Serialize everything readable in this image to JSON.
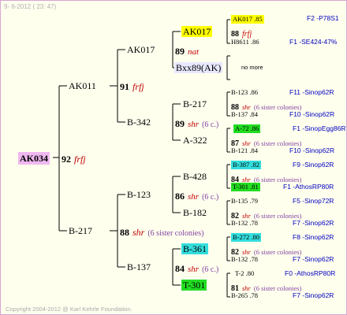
{
  "header": "9- 6-2012 ( 23: 47)",
  "footer": "Copyright 2004-2012 @ Karl Kehrle Foundation.",
  "colors": {
    "root_bg": "#f0b8f0",
    "yellow": "#ffff00",
    "green": "#22dd22",
    "cyan": "#33dddd",
    "blue_text": "#0000c0"
  },
  "root": {
    "name": "AK034",
    "num": "92",
    "type": "frfj"
  },
  "g1": [
    {
      "name": "AK011",
      "num": "91",
      "type": "frfj"
    },
    {
      "name": "B-217",
      "num": "88",
      "type": "shr",
      "sis": "(6 sister colonies)"
    }
  ],
  "g2": [
    {
      "name": "AK017",
      "num": "89",
      "type": "nat"
    },
    {
      "name": "B-342",
      "num": "89",
      "type": "shr",
      "sis": "(6 c.)"
    },
    {
      "name": "B-123",
      "num": "86",
      "type": "shr",
      "sis": "(6 c.)"
    },
    {
      "name": "B-137",
      "num": "84",
      "type": "shr",
      "sis": "(6 c.)"
    }
  ],
  "g3": [
    {
      "name": "AK017"
    },
    {
      "name": "Bxx89(AK)"
    },
    {
      "name": "B-217"
    },
    {
      "name": "A-322"
    },
    {
      "name": "B-428"
    },
    {
      "name": "B-182"
    },
    {
      "name": "B-361"
    },
    {
      "name": "T-301"
    }
  ],
  "g4": [
    {
      "top": "AK017 .85",
      "num": "88",
      "type": "frfj",
      "sis": "",
      "bot": "H8611 .86",
      "rtop": "F2 -P78S1",
      "rbot": "F1 -SE424-47%"
    },
    {
      "top": "",
      "num": "",
      "type": "",
      "sis": "no more",
      "bot": "",
      "rtop": "",
      "rbot": ""
    },
    {
      "top": "B-123 .86",
      "num": "88",
      "type": "shr",
      "sis": "(6 sister colonies)",
      "bot": "B-137 .84",
      "rtop": "F11 -Sinop62R",
      "rbot": "F10 -Sinop62R"
    },
    {
      "top": "A-72 .86",
      "num": "87",
      "type": "shr",
      "sis": "(6 sister colonies)",
      "bot": "B-121 .84",
      "rtop": "F1 -SinopEgg86R",
      "rbot": "F10 -Sinop62R"
    },
    {
      "top": "B-387 .82",
      "num": "84",
      "type": "shr",
      "sis": "(6 sister colonies)",
      "bot": "T-301 .81",
      "rtop": "F9 -Sinop62R",
      "rbot": "F1 -AthosRP80R"
    },
    {
      "top": "B-135 .79",
      "num": "82",
      "type": "shr",
      "sis": "(6 sister colonies)",
      "bot": "B-132 .78",
      "rtop": "F5 -Sinop72R",
      "rbot": "F7 -Sinop62R"
    },
    {
      "top": "B-272 .80",
      "num": "82",
      "type": "shr",
      "sis": "(6 sister colonies)",
      "bot": "B-132 .78",
      "rtop": "F8 -Sinop62R",
      "rbot": "F7 -Sinop62R"
    },
    {
      "top": "T-2 .80",
      "num": "81",
      "type": "shr",
      "sis": "(6 sister colonies)",
      "bot": "B-265 .78",
      "rtop": "F0 -AthosRP80R",
      "rbot": "F7 -Sinop62R"
    }
  ]
}
